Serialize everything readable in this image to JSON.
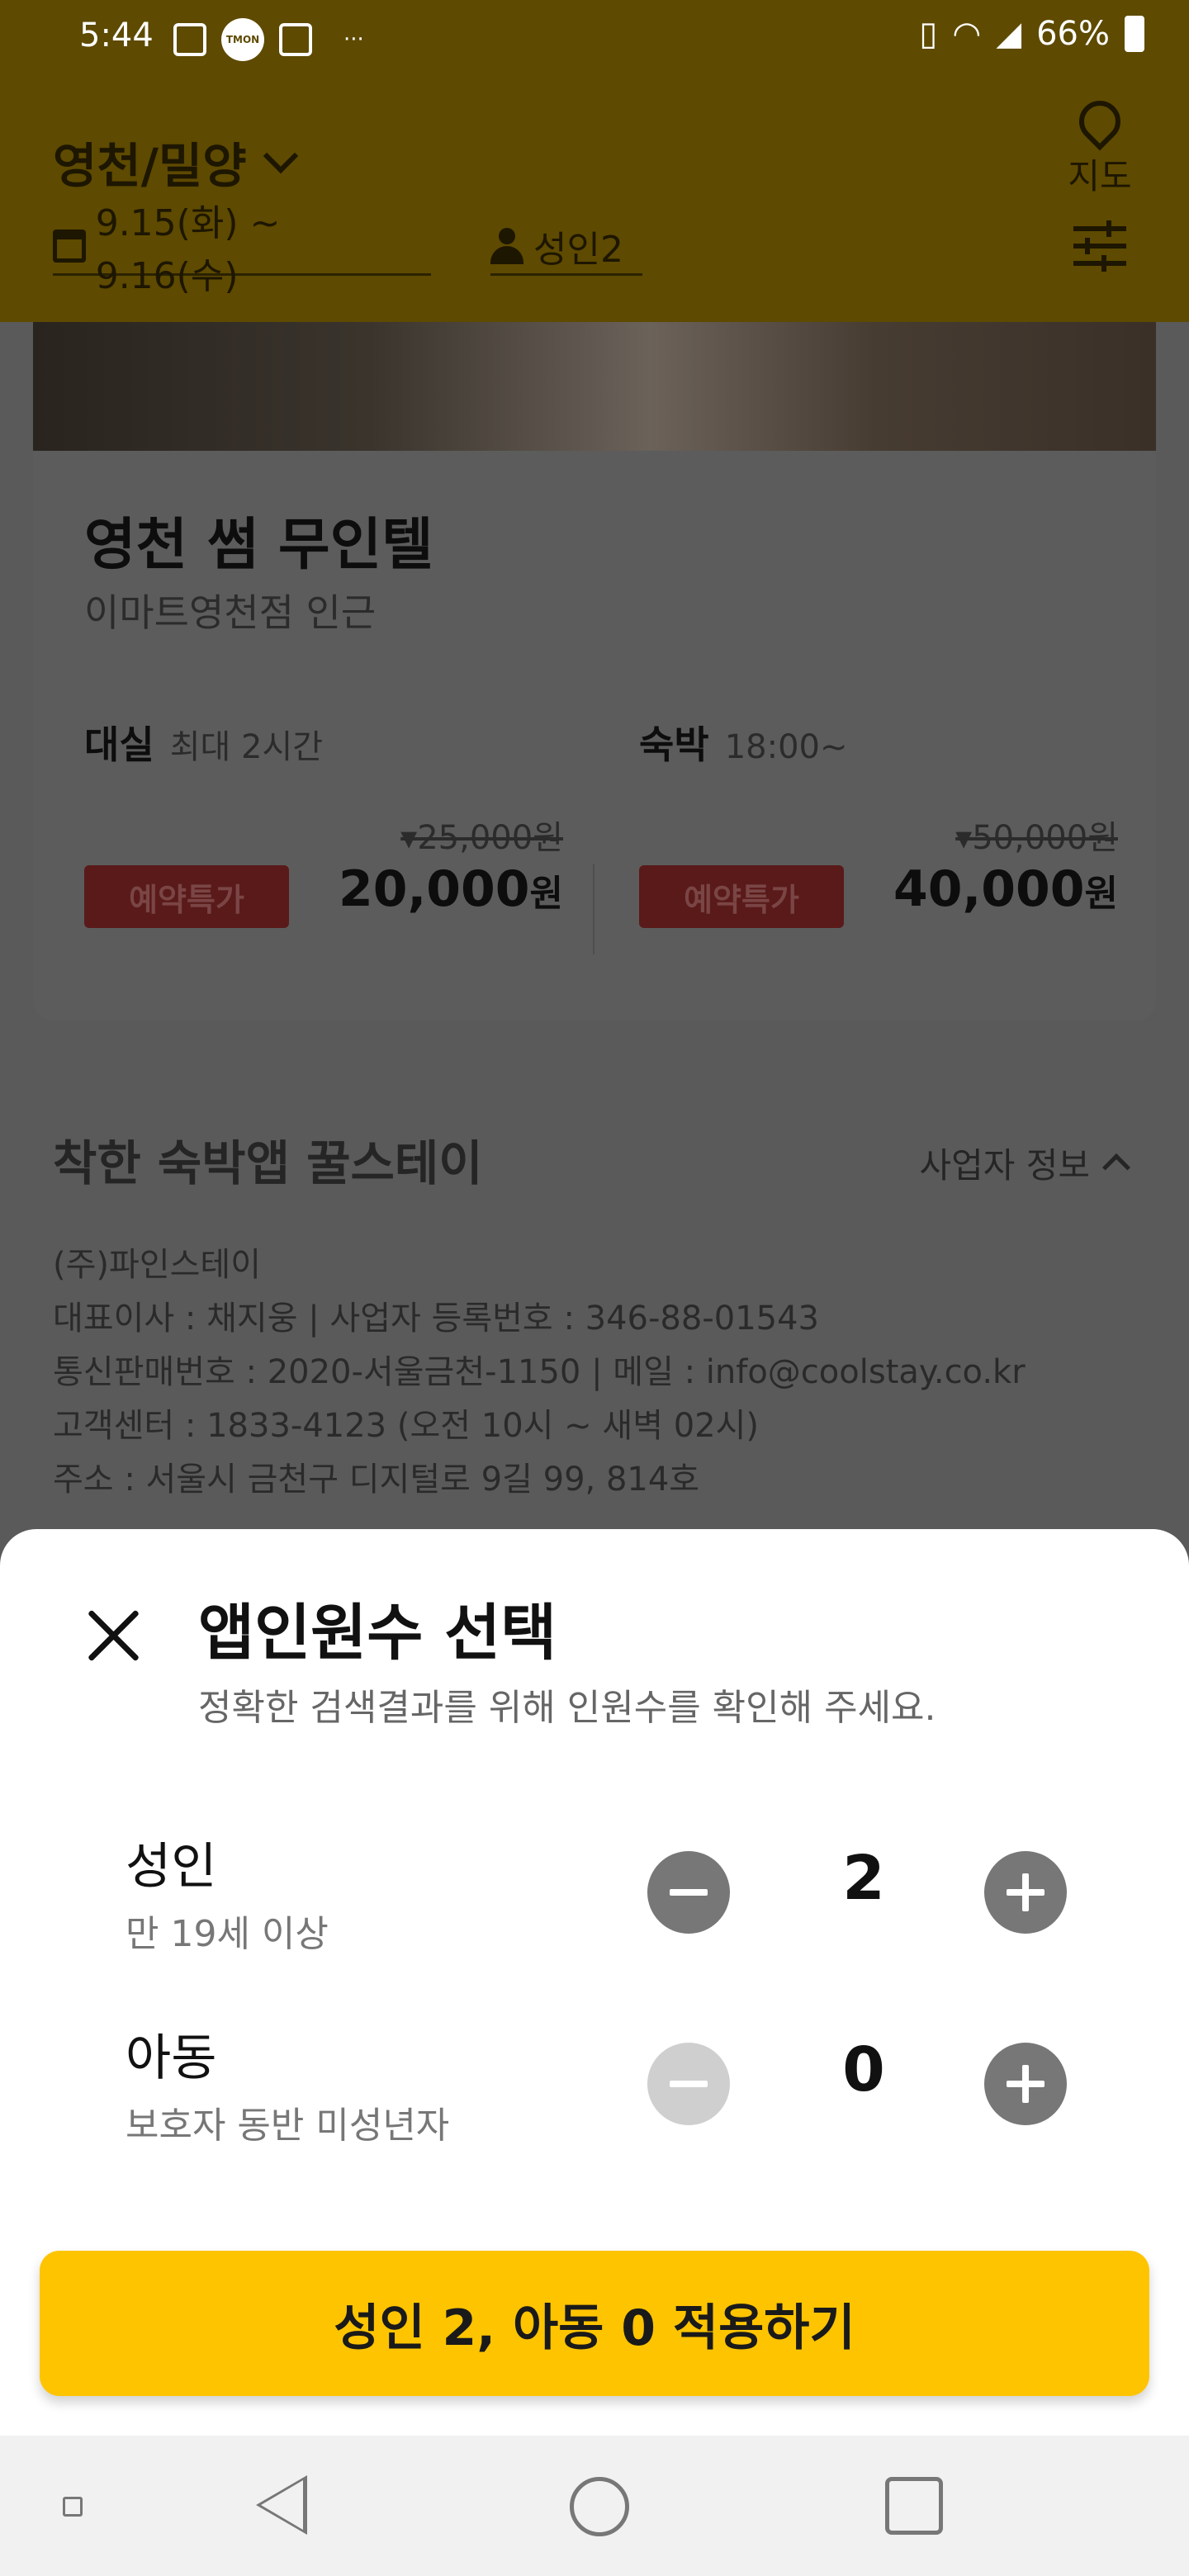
{
  "status_bar": {
    "time": "5:44",
    "battery": "66%",
    "tmon": "TMON",
    "more": "···"
  },
  "header": {
    "region": "영천/밀양",
    "dates": "9.15(화) ~ 9.16(수)",
    "guests": "성인2",
    "map_label": "지도"
  },
  "listing": {
    "name": "영천 썸 무인텔",
    "location": "이마트영천점 인근",
    "rates": [
      {
        "type": "대실",
        "condition": "최대 2시간",
        "original_price": "▾25,000원",
        "badge": "예약특가",
        "price": "20,000",
        "unit": "원"
      },
      {
        "type": "숙박",
        "condition": "18:00~",
        "original_price": "▾50,000원",
        "badge": "예약특가",
        "price": "40,000",
        "unit": "원"
      }
    ]
  },
  "footer": {
    "title": "착한 숙박앱 꿀스테이",
    "business_toggle": "사업자 정보",
    "lines": [
      "(주)파인스테이",
      "대표이사 : 채지웅 | 사업자 등록번호 : 346-88-01543",
      "통신판매번호 : 2020-서울금천-1150 | 메일 : info@coolstay.co.kr",
      "고객센터 : 1833-4123 (오전 10시 ~ 새벽 02시)",
      "주소 : 서울시 금천구 디지털로 9길 99, 814호"
    ]
  },
  "sheet": {
    "title": "앱인원수 선택",
    "subtitle": "정확한 검색결과를 위해 인원수를 확인해 주세요.",
    "adult": {
      "label": "성인",
      "desc": "만 19세 이상",
      "count": "2"
    },
    "child": {
      "label": "아동",
      "desc": "보호자 동반 미성년자",
      "count": "0"
    },
    "apply_label": "성인 2, 아동 0 적용하기"
  },
  "colors": {
    "accent": "#ffc400",
    "stepper": "#777777",
    "stepper_disabled": "#cfcfcf"
  }
}
